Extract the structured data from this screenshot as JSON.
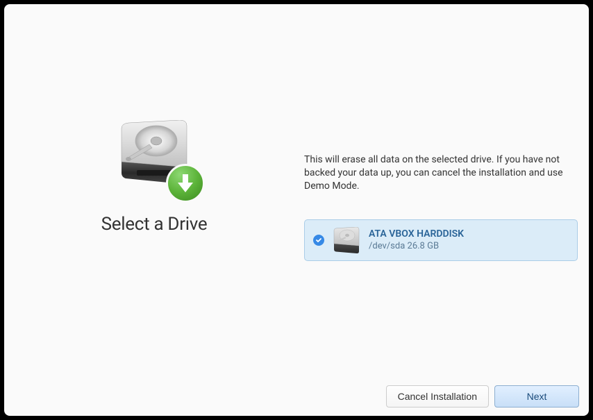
{
  "left": {
    "title": "Select a Drive"
  },
  "right": {
    "warning": "This will erase all data on the selected drive. If you have not backed your data up, you can cancel the installation and use Demo Mode."
  },
  "drive": {
    "name": "ATA VBOX HARDDISK",
    "path": "/dev/sda",
    "size": "26.8 GB"
  },
  "buttons": {
    "cancel": "Cancel Installation",
    "next": "Next"
  }
}
